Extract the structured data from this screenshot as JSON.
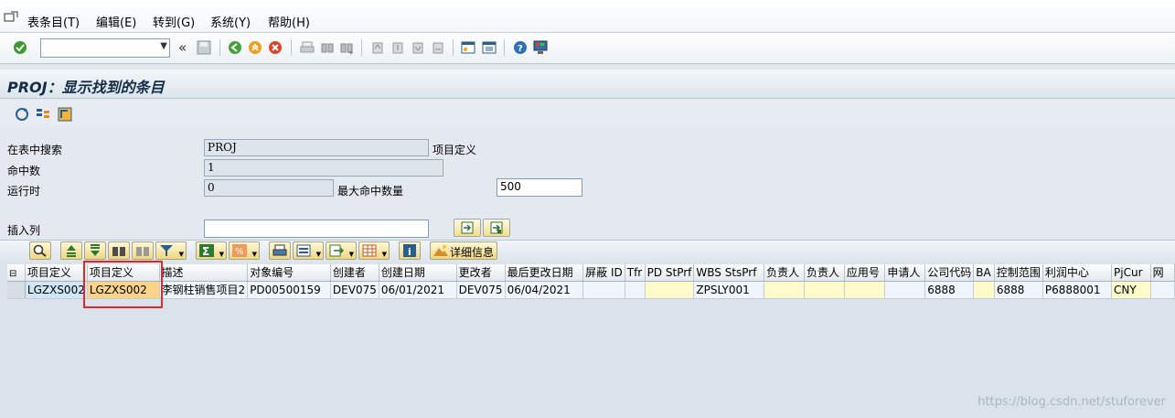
{
  "menu": {
    "items": [
      "表条目(T)",
      "编辑(E)",
      "转到(G)",
      "系统(Y)",
      "帮助(H)"
    ]
  },
  "toolbar": {
    "command_value": "",
    "back_chevrons": "«"
  },
  "title": "PROJ：显示找到的条目",
  "form": {
    "search_table_label": "在表中搜索",
    "search_table_value": "PROJ",
    "search_table_desc": "项目定义",
    "hits_label": "命中数",
    "hits_value": "1",
    "runtime_label": "运行时",
    "runtime_value": "0",
    "max_hits_label": "最大命中数量",
    "max_hits_value": "500",
    "insert_col_label": "插入列",
    "insert_col_value": ""
  },
  "alv": {
    "detail_button": "详细信息"
  },
  "grid": {
    "row_selector_header": "",
    "columns": [
      "项目定义",
      "项目定义",
      "描述",
      "对象编号",
      "创建者",
      "创建日期",
      "更改者",
      "最后更改日期",
      "屏蔽 ID",
      "Tfr",
      "PD StPrf",
      "WBS StsPrf",
      "负责人",
      "负责人",
      "应用号",
      "申请人",
      "公司代码",
      "BA",
      "控制范围",
      "利润中心",
      "PjCur",
      "网"
    ],
    "rows": [
      [
        "LGZXS002",
        "LGZXS002",
        "李钢柱销售项目2",
        "PD00500159",
        "DEV075",
        "06/01/2021",
        "DEV075",
        "06/04/2021",
        "",
        "",
        "",
        "ZPSLY001",
        "",
        "",
        "",
        "",
        "6888",
        "",
        "6888",
        "P6888001",
        "CNY",
        ""
      ]
    ]
  },
  "watermark": "https://blog.csdn.net/stuforever",
  "colors": {
    "title_text": "#142c45",
    "highlight_border": "#e32727",
    "selected_cell": "#fbd48a",
    "key_cell": "#cfe6f7",
    "yellow_cell": "#fdfbc9"
  }
}
